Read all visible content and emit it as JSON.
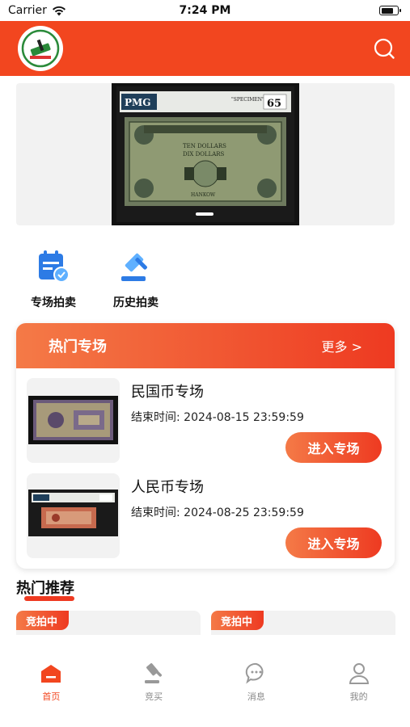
{
  "status_bar": {
    "carrier": "Carrier",
    "time": "7:24 PM",
    "battery_level": 0.8
  },
  "header": {
    "logo_icon": "auction-hammer-logo",
    "search_icon": "search-icon",
    "accent_color": "#f2461f"
  },
  "banner": {
    "image_desc_icon": "banknote-image",
    "grade_label": "PMG",
    "grade_score": "65",
    "specimen_text": "\"SPECIMEN\"",
    "bill_text_top": "TEN DOLLARS",
    "bill_text_bottom": "DIX DOLLARS",
    "bill_city": "HANKOW"
  },
  "quick_links": [
    {
      "label": "专场拍卖",
      "icon": "calendar-auction-icon"
    },
    {
      "label": "历史拍卖",
      "icon": "gavel-history-icon"
    }
  ],
  "hot_sessions": {
    "title": "热门专场",
    "more_label": "更多 >",
    "items": [
      {
        "name": "民国币专场",
        "end_time": "结束时间: 2024-08-15 23:59:59",
        "button": "进入专场"
      },
      {
        "name": "人民币专场",
        "end_time": "结束时间: 2024-08-25 23:59:59",
        "button": "进入专场"
      }
    ]
  },
  "recommend": {
    "title": "热门推荐",
    "cards": [
      {
        "badge": "竞拍中"
      },
      {
        "badge": "竞拍中"
      }
    ]
  },
  "tab_bar": {
    "items": [
      {
        "label": "首页",
        "icon": "home-icon",
        "active": true
      },
      {
        "label": "竞买",
        "icon": "gavel-icon",
        "active": false
      },
      {
        "label": "消息",
        "icon": "message-icon",
        "active": false
      },
      {
        "label": "我的",
        "icon": "profile-icon",
        "active": false
      }
    ]
  }
}
